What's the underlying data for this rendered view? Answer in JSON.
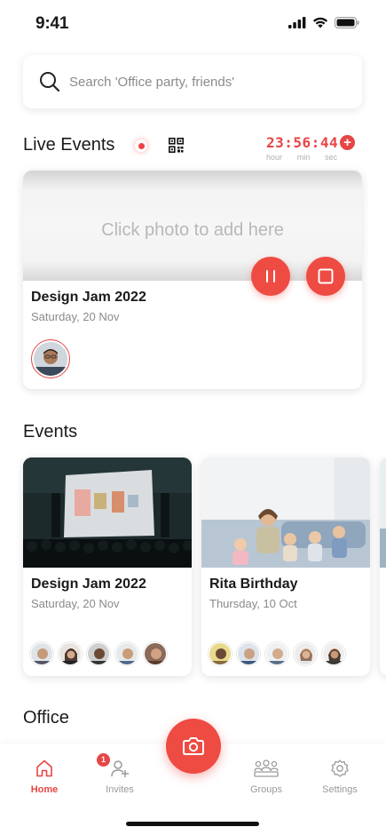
{
  "status_bar": {
    "time": "9:41"
  },
  "search": {
    "placeholder": "Search 'Office party, friends'"
  },
  "live_events": {
    "title": "Live Events",
    "timer": {
      "hours": "23",
      "minutes": "56",
      "seconds": "44",
      "hour_label": "hour",
      "min_label": "min",
      "sec_label": "sec"
    },
    "card": {
      "photo_hint": "Click photo to add here",
      "title": "Design Jam 2022",
      "date": "Saturday, 20 Nov"
    }
  },
  "events": {
    "title": "Events",
    "items": [
      {
        "title": "Design Jam 2022",
        "date": "Saturday, 20 Nov"
      },
      {
        "title": "Rita Birthday",
        "date": "Thursday, 10 Oct"
      }
    ]
  },
  "office": {
    "title": "Office"
  },
  "tabs": [
    {
      "label": "Home",
      "icon": "home-icon",
      "active": true
    },
    {
      "label": "Invites",
      "icon": "add-user-icon",
      "badge": "1"
    },
    {
      "label": "Groups",
      "icon": "groups-icon"
    },
    {
      "label": "Settings",
      "icon": "gear-icon"
    }
  ],
  "colors": {
    "accent": "#EE4B43",
    "timer": "#E84545",
    "text": "#1A1A1A",
    "muted": "#8A8A8A"
  }
}
